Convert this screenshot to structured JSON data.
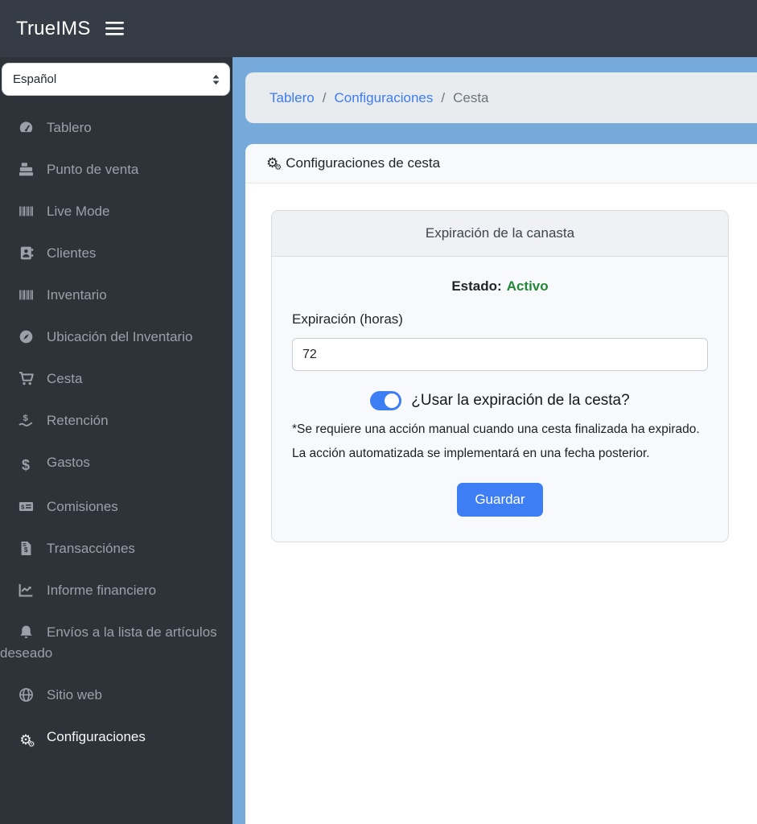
{
  "topbar": {
    "brand": "TrueIMS",
    "menu_icon": "hamburger"
  },
  "sidebar": {
    "language_select": {
      "value": "Español"
    },
    "items": [
      {
        "label": "Tablero",
        "icon": "gauge-icon",
        "active": false
      },
      {
        "label": "Punto de venta",
        "icon": "cash-register-icon",
        "active": false
      },
      {
        "label": "Live Mode",
        "icon": "barcode-icon",
        "active": false
      },
      {
        "label": "Clientes",
        "icon": "address-book-icon",
        "active": false
      },
      {
        "label": "Inventario",
        "icon": "barcode-icon",
        "active": false
      },
      {
        "label": "Ubicación del Inventario",
        "icon": "compass-icon",
        "active": false
      },
      {
        "label": "Cesta",
        "icon": "cart-icon",
        "active": false
      },
      {
        "label": "Retención",
        "icon": "hand-holding-dollar-icon",
        "active": false
      },
      {
        "label": "Gastos",
        "icon": "dollar-icon",
        "active": false
      },
      {
        "label": "Comisiones",
        "icon": "money-check-icon",
        "active": false
      },
      {
        "label": "Transacciónes",
        "icon": "file-invoice-dollar-icon",
        "active": false
      },
      {
        "label": "Informe financiero",
        "icon": "chart-line-icon",
        "active": false
      },
      {
        "label": "Envíos a la lista de artículos deseado",
        "icon": "bell-icon",
        "active": false
      },
      {
        "label": "Sitio web",
        "icon": "globe-icon",
        "active": false
      },
      {
        "label": "Configuraciones",
        "icon": "gears-icon",
        "active": true
      }
    ]
  },
  "breadcrumb": {
    "separator": "/",
    "items": [
      {
        "label": "Tablero",
        "link": true
      },
      {
        "label": "Configuraciones",
        "link": true
      },
      {
        "label": "Cesta",
        "link": false
      }
    ]
  },
  "panel": {
    "title": "Configuraciones de cesta"
  },
  "card": {
    "title": "Expiración de la canasta",
    "status_label": "Estado:",
    "status_value": "Activo",
    "expiration_label": "Expiración (horas)",
    "expiration_value": "72",
    "toggle_label": "¿Usar la expiración de la cesta?",
    "toggle_on": true,
    "note": "*Se requiere una acción manual cuando una cesta finalizada ha expirado. La acción automatizada se implementará en una fecha posterior.",
    "save_label": "Guardar"
  },
  "colors": {
    "topbar_bg": "#363c45",
    "sidebar_bg": "#2e333a",
    "content_bg": "#76aada",
    "accent_blue": "#3d7ef5",
    "link_blue": "#3c7bf2",
    "status_green": "#218838"
  }
}
